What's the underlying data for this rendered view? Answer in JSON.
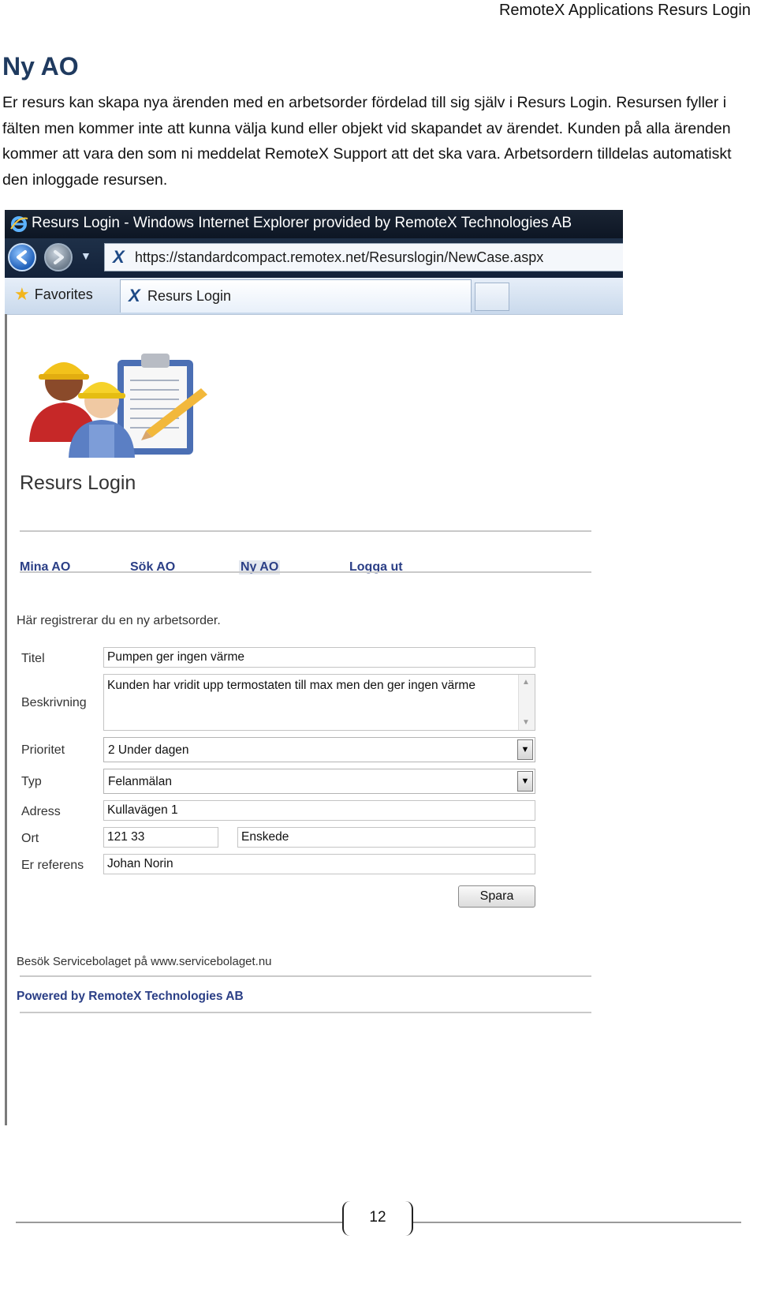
{
  "doc": {
    "header": "RemoteX Applications Resurs Login",
    "title": "Ny AO",
    "intro": "Er resurs kan skapa nya ärenden med en arbetsorder fördelad till sig själv i Resurs Login. Resursen fyller i fälten men kommer inte att kunna välja kund eller objekt vid skapandet av ärendet.  Kunden på alla ärenden kommer att vara den som ni meddelat RemoteX Support att det ska vara. Arbetsordern tilldelas automatiskt den inloggade resursen.",
    "page_number": "12"
  },
  "browser": {
    "title": "Resurs Login - Windows Internet Explorer provided by RemoteX Technologies AB",
    "url": "https://standardcompact.remotex.net/Resurslogin/NewCase.aspx",
    "favorites": "Favorites",
    "tab_label": "Resurs Login"
  },
  "app": {
    "title": "Resurs Login",
    "menu": [
      "Mina AO",
      "Sök AO",
      "Ny AO",
      "Logga ut"
    ],
    "lead": "Här registrerar du en ny arbetsorder.",
    "form": {
      "titel_label": "Titel",
      "titel_value": "Pumpen ger ingen värme",
      "beskrivning_label": "Beskrivning",
      "beskrivning_value": "Kunden har vridit upp termostaten till max men den ger ingen värme",
      "prioritet_label": "Prioritet",
      "prioritet_value": "2 Under dagen",
      "typ_label": "Typ",
      "typ_value": "Felanmälan",
      "adress_label": "Adress",
      "adress_value": "Kullavägen 1",
      "ort_label": "Ort",
      "postnr_value": "121 33",
      "ort_value": "Enskede",
      "ref_label": "Er referens",
      "ref_value": "Johan Norin",
      "save_label": "Spara"
    },
    "footer_visit": "Besök Servicebolaget på www.servicebolaget.nu",
    "footer_powered": "Powered by RemoteX Technologies AB"
  },
  "colors": {
    "doc_title": "#1f3a5f",
    "link_blue": "#2b3f86",
    "ie_titlebar": "#1a2433"
  },
  "icons": [
    "ie-logo-icon",
    "back-arrow-icon",
    "forward-arrow-icon",
    "remotex-x-icon",
    "favorites-star-icon",
    "dropdown-arrow-icon"
  ]
}
